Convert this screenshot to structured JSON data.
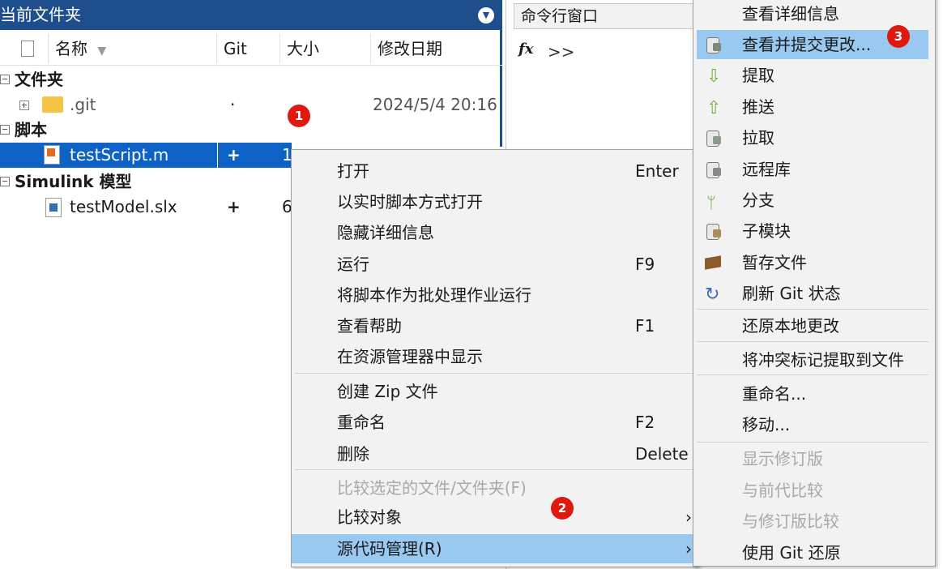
{
  "folder_panel": {
    "title": "当前文件夹",
    "headers": {
      "name": "名称",
      "git": "Git",
      "size": "大小",
      "date": "修改日期"
    },
    "groups": [
      "文件夹",
      "脚本",
      "Simulink 模型"
    ],
    "rows": [
      {
        "name": ".git",
        "git": "·",
        "size": "",
        "date": "2024/5/4 20:16"
      },
      {
        "name": "testScript.m",
        "git": "+",
        "size": "1",
        "date": ""
      },
      {
        "name": "testModel.slx",
        "git": "+",
        "size": "6",
        "date": ""
      }
    ]
  },
  "command_window": {
    "title": "命令行窗口",
    "fx": "fx",
    "prompt": ">>"
  },
  "context_menu": {
    "items": [
      {
        "label": "打开",
        "shortcut": "Enter"
      },
      {
        "label": "以实时脚本方式打开",
        "shortcut": ""
      },
      {
        "label": "隐藏详细信息",
        "shortcut": ""
      },
      {
        "label": "运行",
        "shortcut": "F9"
      },
      {
        "label": "将脚本作为批处理作业运行",
        "shortcut": ""
      },
      {
        "label": "查看帮助",
        "shortcut": "F1"
      },
      {
        "label": "在资源管理器中显示",
        "shortcut": ""
      },
      {
        "label": "创建 Zip 文件",
        "shortcut": ""
      },
      {
        "label": "重命名",
        "shortcut": "F2"
      },
      {
        "label": "删除",
        "shortcut": "Delete"
      },
      {
        "label": "比较选定的文件/文件夹(F)",
        "shortcut": ""
      },
      {
        "label": "比较对象",
        "shortcut": ""
      },
      {
        "label": "源代码管理(R)",
        "shortcut": ""
      }
    ],
    "arrow": "›"
  },
  "submenu": {
    "items": [
      {
        "label": "查看详细信息",
        "icon": "none"
      },
      {
        "label": "查看并提交更改...",
        "icon": "commit-icon"
      },
      {
        "label": "提取",
        "icon": "fetch-icon"
      },
      {
        "label": "推送",
        "icon": "push-icon"
      },
      {
        "label": "拉取",
        "icon": "pull-icon"
      },
      {
        "label": "远程库",
        "icon": "remote-icon"
      },
      {
        "label": "分支",
        "icon": "branch-icon"
      },
      {
        "label": "子模块",
        "icon": "submodule-icon"
      },
      {
        "label": "暂存文件",
        "icon": "stash-icon"
      },
      {
        "label": "刷新 Git 状态",
        "icon": "refresh-icon"
      },
      {
        "label": "还原本地更改",
        "icon": "none"
      },
      {
        "label": "将冲突标记提取到文件",
        "icon": "none"
      },
      {
        "label": "重命名...",
        "icon": "none"
      },
      {
        "label": "移动...",
        "icon": "none"
      },
      {
        "label": "显示修订版",
        "icon": "none"
      },
      {
        "label": "与前代比较",
        "icon": "none"
      },
      {
        "label": "与修订版比较",
        "icon": "none"
      },
      {
        "label": "使用 Git 还原",
        "icon": "none"
      }
    ]
  },
  "badges": [
    "1",
    "2",
    "3"
  ],
  "colors": {
    "title_bar": "#1f4e8c",
    "selection": "#0e62c6",
    "menu_highlight": "#99c9f1",
    "badge": "#e0190f"
  }
}
